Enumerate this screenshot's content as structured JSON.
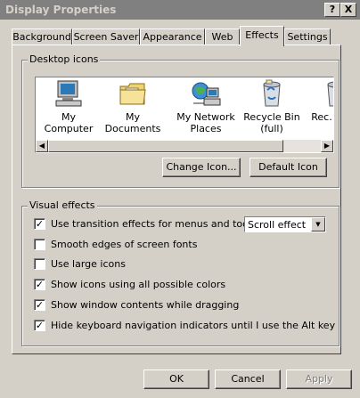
{
  "window": {
    "title": "Display Properties",
    "help_label": "?",
    "close_label": "X"
  },
  "tabs": [
    {
      "label": "Background"
    },
    {
      "label": "Screen Saver"
    },
    {
      "label": "Appearance"
    },
    {
      "label": "Web"
    },
    {
      "label": "Effects",
      "active": true
    },
    {
      "label": "Settings"
    }
  ],
  "desktop_icons": {
    "label": "Desktop icons",
    "items": [
      {
        "label": "My Computer",
        "icon": "my-computer-icon"
      },
      {
        "label": "My Documents",
        "icon": "my-documents-icon"
      },
      {
        "label": "My Network Places",
        "icon": "my-network-places-icon"
      },
      {
        "label": "Recycle Bin (full)",
        "icon": "recycle-bin-full-icon"
      },
      {
        "label": "Rec... (e...",
        "icon": "recycle-bin-empty-icon"
      }
    ],
    "change_icon_label": "Change Icon...",
    "default_icon_label": "Default Icon"
  },
  "visual_effects": {
    "label": "Visual effects",
    "options": [
      {
        "label": "Use transition effects for menus and tooltips",
        "checked": true
      },
      {
        "label": "Smooth edges of screen fonts",
        "checked": false
      },
      {
        "label": "Use large icons",
        "checked": false
      },
      {
        "label": "Show icons using all possible colors",
        "checked": true
      },
      {
        "label": "Show window contents while dragging",
        "checked": true
      },
      {
        "label": "Hide keyboard navigation indicators until I use the Alt key",
        "checked": true
      }
    ],
    "transition_effect_value": "Scroll effect"
  },
  "footer": {
    "ok_label": "OK",
    "cancel_label": "Cancel",
    "apply_label": "Apply"
  }
}
